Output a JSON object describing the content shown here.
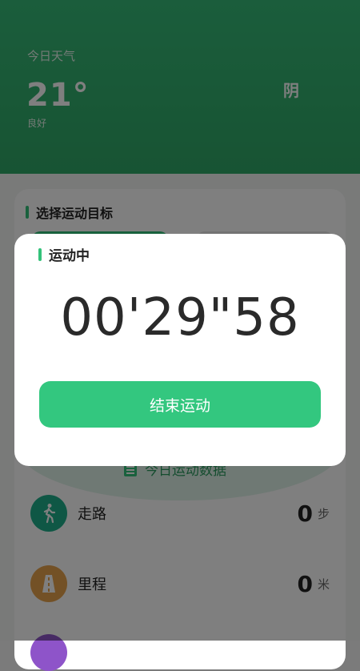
{
  "weather": {
    "label": "今日天气",
    "temperature": "21°",
    "air_quality": "良好",
    "condition": "阴"
  },
  "goal_section": {
    "title": "选择运动目标"
  },
  "today_section": {
    "title": "今日运动数据"
  },
  "stats": [
    {
      "label": "走路",
      "value": "0",
      "unit": "步",
      "icon": "walking-person-icon",
      "color": "#1fae8a"
    },
    {
      "label": "里程",
      "value": "0",
      "unit": "米",
      "icon": "road-icon",
      "color": "#e6a24d"
    }
  ],
  "dialog": {
    "title": "运动中",
    "timer": "00'29\"58",
    "end_button": "结束运动"
  },
  "colors": {
    "accent": "#33c27a",
    "weather_bg": "#36bb78"
  }
}
